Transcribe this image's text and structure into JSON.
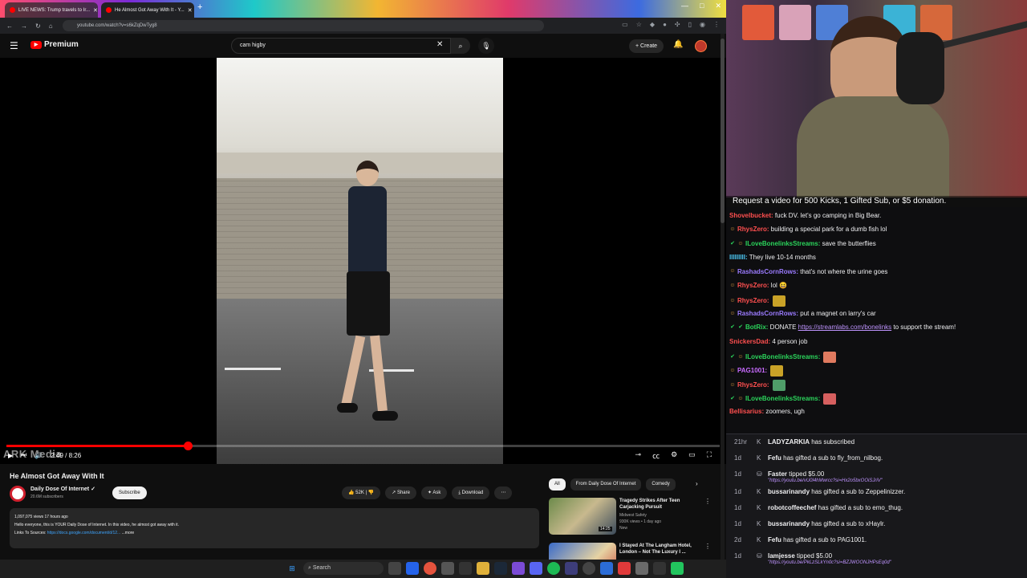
{
  "browser": {
    "tabs": [
      {
        "title": "LIVE NEWS: Trump travels to Ir...",
        "active": false
      },
      {
        "title": "He Almost Got Away With It - Y...",
        "active": true
      }
    ],
    "new_tab_icon": "plus-icon",
    "window_controls": {
      "minimize": "—",
      "maximize": "□",
      "close": "✕"
    },
    "url": "youtube.com/watch?v=s6kZqDwTyg8"
  },
  "youtube": {
    "brand": "Premium",
    "search_query": "cam higby",
    "create_label": "Create",
    "video": {
      "title": "He Almost Got Away With It",
      "time_display": "2:49 / 8:26",
      "progress": 0.254,
      "buffered": 0.33,
      "watermark": "ARK Media"
    },
    "channel": {
      "name": "Daily Dose Of Internet",
      "verified": true,
      "subscribers": "20.6M subscribers",
      "subscribe_label": "Subscribe"
    },
    "actions": {
      "likes": "52K",
      "share": "Share",
      "ask": "Ask",
      "download": "Download"
    },
    "description": {
      "stats": "1,097,075 views  17 hours ago",
      "line1": "Hello everyone, this is YOUR Daily Dose of Internet. In this video, he almost got away with it.",
      "links_label": "Links To Sources:",
      "link": "https://docs.google.com/document/d/12...",
      "more": "...more"
    },
    "chips": [
      {
        "label": "All",
        "active": true
      },
      {
        "label": "From Daily Dose Of Internet",
        "active": false
      },
      {
        "label": "Comedy",
        "active": false
      }
    ],
    "recommendations": [
      {
        "title": "Tragedy Strikes After Teen Carjacking Pursuit",
        "channel": "Midwest Safety",
        "meta": "930K views • 1 day ago",
        "badge": "New",
        "duration": "14:25"
      },
      {
        "title": "I Stayed At The Langham Hotel, London – Not The Luxury I ...",
        "channel": "",
        "meta": "",
        "badge": "",
        "duration": ""
      }
    ]
  },
  "stream": {
    "caption": "Request a video for 500 Kicks, 1 Gifted Sub, or $5 donation.",
    "chat": [
      {
        "user": "Shovelbucket",
        "color": "#ff4f4f",
        "badges": [],
        "text": "fuck DV. let's go camping in Big Bear."
      },
      {
        "user": "RhysZero",
        "color": "#ff4f4f",
        "badges": [
          "sub"
        ],
        "text": "building a special park for a dumb fish lol"
      },
      {
        "user": "ILoveBonelinksStreams",
        "color": "#2bd45b",
        "badges": [
          "mod",
          "sub"
        ],
        "text": "save the butterflies"
      },
      {
        "user": "lllllllll",
        "color": "#4fd1ff",
        "badges": [],
        "text": "They live 10-14 months"
      },
      {
        "user": "RashadsCornRows",
        "color": "#9b7bff",
        "badges": [
          "sub"
        ],
        "text": "that's not where the urine goes"
      },
      {
        "user": "RhysZero",
        "color": "#ff4f4f",
        "badges": [
          "sub"
        ],
        "text": "lol 😆"
      },
      {
        "user": "RhysZero",
        "color": "#ff4f4f",
        "badges": [
          "sub"
        ],
        "text": "",
        "emote": true
      },
      {
        "user": "RashadsCornRows",
        "color": "#9b7bff",
        "badges": [
          "sub"
        ],
        "text": "put a magnet on larry's car"
      },
      {
        "user": "BotRix",
        "color": "#2bd45b",
        "badges": [
          "mod",
          "verified"
        ],
        "text": "DONATE",
        "link": "https://streamlabs.com/bonelinks",
        "text_after": "to support the stream!"
      },
      {
        "user": "SnickersDad",
        "color": "#ff4f4f",
        "badges": [],
        "text": "4 person job"
      },
      {
        "user": "ILoveBonelinksStreams",
        "color": "#2bd45b",
        "badges": [
          "mod",
          "sub"
        ],
        "text": "",
        "emote": true
      },
      {
        "user": "PAG1001",
        "color": "#c86bff",
        "badges": [
          "sub"
        ],
        "text": "",
        "emote": true
      },
      {
        "user": "RhysZero",
        "color": "#ff4f4f",
        "badges": [
          "sub"
        ],
        "text": "",
        "emote": true
      },
      {
        "user": "ILoveBonelinksStreams",
        "color": "#2bd45b",
        "badges": [
          "mod",
          "sub"
        ],
        "text": "",
        "emote": true
      },
      {
        "user": "Bellisarius",
        "color": "#ff4f4f",
        "badges": [],
        "text": "zoomers, ugh"
      }
    ],
    "events": [
      {
        "age": "21hr",
        "icon": "kick-icon",
        "text": "LADYZARKIA has subscribed",
        "user": "LADYZARKIA",
        "sub": ""
      },
      {
        "age": "1d",
        "icon": "kick-icon",
        "text": "Fefu has gifted a sub to fly_from_nilbog.",
        "user": "Fefu",
        "sub": ""
      },
      {
        "age": "1d",
        "icon": "tip-icon",
        "text": "Faster tipped $5.00",
        "user": "Faster",
        "sub": "\"https://youtu.be/vU0l4hMwrcc?si=Hx2o5bxOOiSJriV\""
      },
      {
        "age": "1d",
        "icon": "kick-icon",
        "text": "bussarinandy has gifted a sub to Zeppelinizzer.",
        "user": "bussarinandy",
        "sub": ""
      },
      {
        "age": "1d",
        "icon": "kick-icon",
        "text": "robotcoffeechef has gifted a sub to emo_thug.",
        "user": "robotcoffeechef",
        "sub": ""
      },
      {
        "age": "1d",
        "icon": "kick-icon",
        "text": "bussarinandy has gifted a sub to xHaylr.",
        "user": "bussarinandy",
        "sub": ""
      },
      {
        "age": "2d",
        "icon": "kick-icon",
        "text": "Fefu has gifted a sub to PAG1001.",
        "user": "Fefu",
        "sub": ""
      },
      {
        "age": "1d",
        "icon": "tip-icon",
        "text": "lamjesse tipped $5.00",
        "user": "lamjesse",
        "sub": "\"https://youtu.be/PkLzSLkYn0c?si=BZJWOONJHPsEq0d\""
      }
    ]
  },
  "taskbar": {
    "search_label": "Search"
  },
  "colors": {
    "yt_red": "#ff0000",
    "chat_bg": "#0e0e10",
    "link_purple": "#bf94ff",
    "yt_link": "#3ea6ff"
  }
}
